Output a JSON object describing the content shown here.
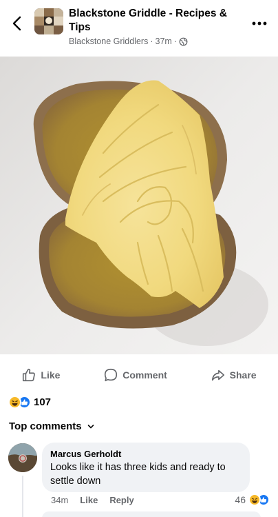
{
  "header": {
    "group_name": "Blackstone Griddle - Recipes & Tips",
    "author": "Blackstone Griddlers",
    "time": "37m",
    "separator": "·",
    "privacy_icon": "globe-icon",
    "back_icon": "chevron-left-icon",
    "more_icon": "more-dots-icon"
  },
  "photo": {
    "icon": "post-photo"
  },
  "actions": {
    "like": "Like",
    "comment": "Comment",
    "share": "Share"
  },
  "reactions": {
    "count": "107",
    "icons": [
      "haha-icon",
      "like-icon"
    ]
  },
  "comments": {
    "header": "Top comments",
    "items": [
      {
        "author": "Marcus Gerholdt",
        "text": "Looks like it has three kids and ready to settle down",
        "time": "34m",
        "like_label": "Like",
        "reply_label": "Reply",
        "reaction_count": "46"
      }
    ]
  },
  "colors": {
    "secondary_text": "#65676b",
    "bubble_bg": "#f0f2f5",
    "like_blue": "#1877f2",
    "haha_yellow": "#f7b928"
  }
}
